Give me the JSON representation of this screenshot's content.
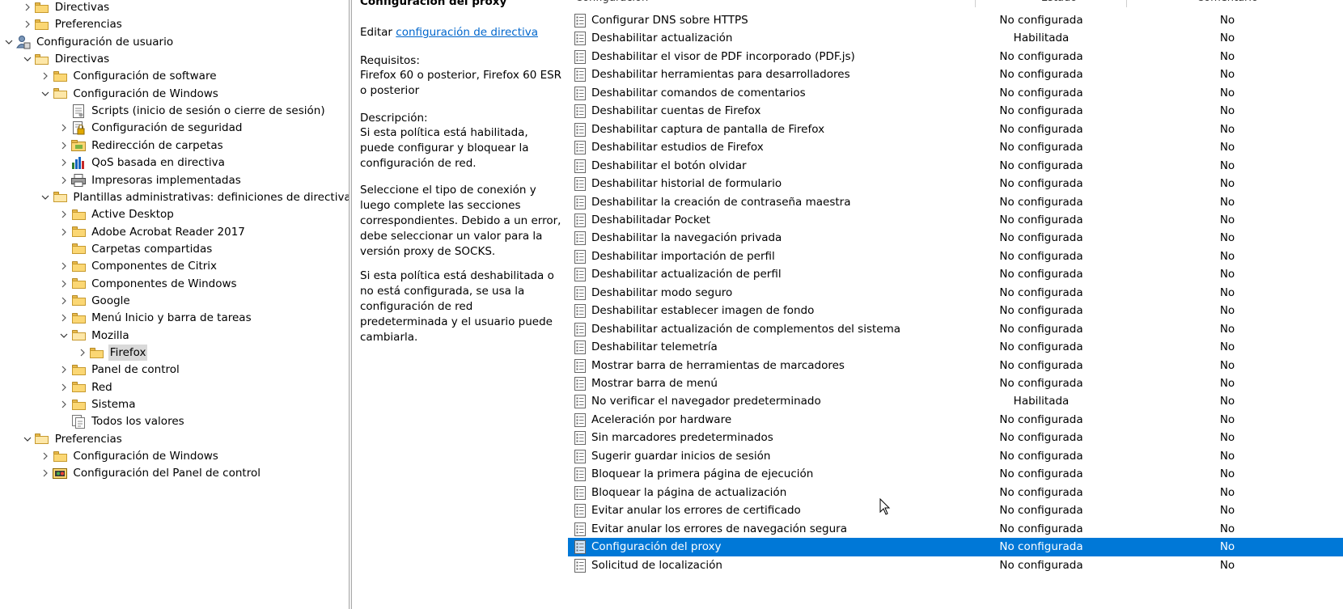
{
  "tree": [
    {
      "id": "directivas-top",
      "label": "Directivas",
      "indent": 1,
      "arrow": "right",
      "icon": "folder"
    },
    {
      "id": "preferencias-top",
      "label": "Preferencias",
      "indent": 1,
      "arrow": "right",
      "icon": "folder"
    },
    {
      "id": "config-usuario",
      "label": "Configuración de usuario",
      "indent": 0,
      "arrow": "down",
      "icon": "user-config"
    },
    {
      "id": "directivas",
      "label": "Directivas",
      "indent": 1,
      "arrow": "down",
      "icon": "folder-open"
    },
    {
      "id": "config-software",
      "label": "Configuración de software",
      "indent": 2,
      "arrow": "right",
      "icon": "folder"
    },
    {
      "id": "config-windows",
      "label": "Configuración de Windows",
      "indent": 2,
      "arrow": "down",
      "icon": "folder-open"
    },
    {
      "id": "scripts",
      "label": "Scripts (inicio de sesión o cierre de sesión)",
      "indent": 3,
      "arrow": "none",
      "icon": "script"
    },
    {
      "id": "config-seguridad",
      "label": "Configuración de seguridad",
      "indent": 3,
      "arrow": "right",
      "icon": "security"
    },
    {
      "id": "redireccion",
      "label": "Redirección de carpetas",
      "indent": 3,
      "arrow": "right",
      "icon": "folder-green"
    },
    {
      "id": "qos",
      "label": "QoS basada en directiva",
      "indent": 3,
      "arrow": "right",
      "icon": "chart"
    },
    {
      "id": "impresoras",
      "label": "Impresoras implementadas",
      "indent": 3,
      "arrow": "right",
      "icon": "printer"
    },
    {
      "id": "plantillas",
      "label": "Plantillas administrativas: definiciones de directiva",
      "indent": 2,
      "arrow": "down",
      "icon": "folder-open"
    },
    {
      "id": "active-desktop",
      "label": "Active Desktop",
      "indent": 3,
      "arrow": "right",
      "icon": "folder"
    },
    {
      "id": "acrobat",
      "label": "Adobe Acrobat Reader 2017",
      "indent": 3,
      "arrow": "right",
      "icon": "folder"
    },
    {
      "id": "carpetas-compartidas",
      "label": "Carpetas compartidas",
      "indent": 3,
      "arrow": "none",
      "icon": "folder"
    },
    {
      "id": "citrix",
      "label": "Componentes de Citrix",
      "indent": 3,
      "arrow": "right",
      "icon": "folder"
    },
    {
      "id": "comp-windows",
      "label": "Componentes de Windows",
      "indent": 3,
      "arrow": "right",
      "icon": "folder"
    },
    {
      "id": "google",
      "label": "Google",
      "indent": 3,
      "arrow": "right",
      "icon": "folder"
    },
    {
      "id": "menu-inicio",
      "label": "Menú Inicio y barra de tareas",
      "indent": 3,
      "arrow": "right",
      "icon": "folder"
    },
    {
      "id": "mozilla",
      "label": "Mozilla",
      "indent": 3,
      "arrow": "down",
      "icon": "folder-open"
    },
    {
      "id": "firefox",
      "label": "Firefox",
      "indent": 4,
      "arrow": "right",
      "icon": "folder",
      "selected": true
    },
    {
      "id": "panel-control",
      "label": "Panel de control",
      "indent": 3,
      "arrow": "right",
      "icon": "folder"
    },
    {
      "id": "red",
      "label": "Red",
      "indent": 3,
      "arrow": "right",
      "icon": "folder"
    },
    {
      "id": "sistema",
      "label": "Sistema",
      "indent": 3,
      "arrow": "right",
      "icon": "folder"
    },
    {
      "id": "todos-valores",
      "label": "Todos los valores",
      "indent": 3,
      "arrow": "none",
      "icon": "all-settings"
    },
    {
      "id": "preferencias",
      "label": "Preferencias",
      "indent": 1,
      "arrow": "down",
      "icon": "folder-open"
    },
    {
      "id": "pref-config-windows",
      "label": "Configuración de Windows",
      "indent": 2,
      "arrow": "right",
      "icon": "folder"
    },
    {
      "id": "pref-panel-control",
      "label": "Configuración del Panel de control",
      "indent": 2,
      "arrow": "right",
      "icon": "control-panel"
    }
  ],
  "description": {
    "title": "Configuración del proxy",
    "edit_prefix": "Editar ",
    "edit_link": "configuración de directiva",
    "requirements_label": "Requisitos:",
    "requirements_text": "Firefox 60 o posterior, Firefox 60 ESR o posterior",
    "description_label": "Descripción:",
    "paragraph1": "Si esta política está habilitada, puede configurar y bloquear la configuración de red.",
    "paragraph2": "Seleccione el tipo de conexión y luego complete las secciones correspondientes. Debido a un error, debe seleccionar un valor para la versión proxy de SOCKS.",
    "paragraph3": "Si esta política está deshabilitada o no está configurada, se usa la configuración de red predeterminada y el usuario puede cambiarla."
  },
  "list": {
    "headers": {
      "setting": "Configuración",
      "state": "Estado",
      "comment": "Comentario"
    },
    "rows": [
      {
        "name": "Configurar DNS sobre HTTPS",
        "state": "No configurada",
        "comment": "No"
      },
      {
        "name": "Deshabilitar actualización",
        "state": "Habilitada",
        "comment": "No"
      },
      {
        "name": "Deshabilitar el visor de PDF incorporado (PDF.js)",
        "state": "No configurada",
        "comment": "No"
      },
      {
        "name": "Deshabilitar herramientas para desarrolladores",
        "state": "No configurada",
        "comment": "No"
      },
      {
        "name": "Deshabilitar comandos de comentarios",
        "state": "No configurada",
        "comment": "No"
      },
      {
        "name": "Deshabilitar cuentas de Firefox",
        "state": "No configurada",
        "comment": "No"
      },
      {
        "name": "Deshabilitar captura de pantalla de Firefox",
        "state": "No configurada",
        "comment": "No"
      },
      {
        "name": "Deshabilitar estudios de Firefox",
        "state": "No configurada",
        "comment": "No"
      },
      {
        "name": "Deshabilitar el botón olvidar",
        "state": "No configurada",
        "comment": "No"
      },
      {
        "name": "Deshabilitar historial de formulario",
        "state": "No configurada",
        "comment": "No"
      },
      {
        "name": "Deshabilitar la creación de contraseña maestra",
        "state": "No configurada",
        "comment": "No"
      },
      {
        "name": "Deshabilitadar Pocket",
        "state": "No configurada",
        "comment": "No"
      },
      {
        "name": "Deshabilitar la navegación privada",
        "state": "No configurada",
        "comment": "No"
      },
      {
        "name": "Deshabilitar importación de perfil",
        "state": "No configurada",
        "comment": "No"
      },
      {
        "name": "Deshabilitar actualización de perfil",
        "state": "No configurada",
        "comment": "No"
      },
      {
        "name": "Deshabilitar modo seguro",
        "state": "No configurada",
        "comment": "No"
      },
      {
        "name": "Deshabilitar establecer imagen de fondo",
        "state": "No configurada",
        "comment": "No"
      },
      {
        "name": "Deshabilitar actualización de complementos del sistema",
        "state": "No configurada",
        "comment": "No"
      },
      {
        "name": "Deshabilitar telemetría",
        "state": "No configurada",
        "comment": "No"
      },
      {
        "name": "Mostrar barra de herramientas de marcadores",
        "state": "No configurada",
        "comment": "No"
      },
      {
        "name": "Mostrar barra de menú",
        "state": "No configurada",
        "comment": "No"
      },
      {
        "name": "No verificar el navegador predeterminado",
        "state": "Habilitada",
        "comment": "No"
      },
      {
        "name": "Aceleración por hardware",
        "state": "No configurada",
        "comment": "No"
      },
      {
        "name": "Sin marcadores predeterminados",
        "state": "No configurada",
        "comment": "No"
      },
      {
        "name": "Sugerir guardar inicios de sesión",
        "state": "No configurada",
        "comment": "No"
      },
      {
        "name": "Bloquear la primera página de ejecución",
        "state": "No configurada",
        "comment": "No"
      },
      {
        "name": "Bloquear la página de actualización",
        "state": "No configurada",
        "comment": "No"
      },
      {
        "name": "Evitar anular los errores de certificado",
        "state": "No configurada",
        "comment": "No"
      },
      {
        "name": "Evitar anular los errores de navegación segura",
        "state": "No configurada",
        "comment": "No"
      },
      {
        "name": "Configuración del proxy",
        "state": "No configurada",
        "comment": "No",
        "selected": true
      },
      {
        "name": "Solicitud de localización",
        "state": "No configurada",
        "comment": "No"
      }
    ]
  },
  "colors": {
    "selection": "#0078d7",
    "link": "#0066cc",
    "tree_selection": "#d9d9d9"
  }
}
